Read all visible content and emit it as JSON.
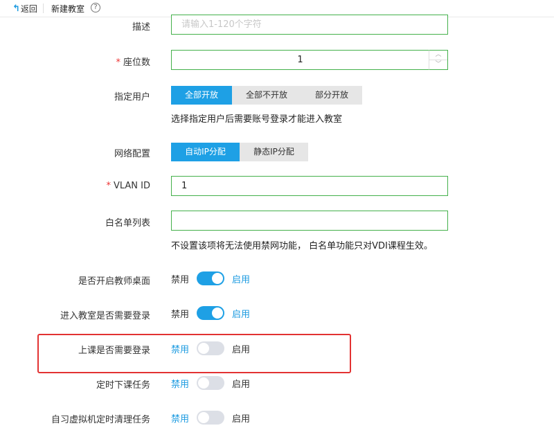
{
  "header": {
    "back_label": "返回",
    "title": "新建教室",
    "help_icon": "?"
  },
  "form": {
    "description": {
      "label": "描述",
      "placeholder": "请输入1-120个字符"
    },
    "seats": {
      "label": "座位数",
      "required_mark": "*",
      "value": "1"
    },
    "assign_user": {
      "label": "指定用户",
      "options": [
        "全部开放",
        "全部不开放",
        "部分开放"
      ],
      "selected": "全部开放",
      "hint": "选择指定用户后需要账号登录才能进入教室"
    },
    "network": {
      "label": "网络配置",
      "options": [
        "自动IP分配",
        "静态IP分配"
      ],
      "selected": "自动IP分配"
    },
    "vlan": {
      "label": "VLAN ID",
      "required_mark": "*",
      "value": "1"
    },
    "whitelist": {
      "label": "白名单列表",
      "value": "",
      "hint": "不设置该项将无法使用禁网功能， 白名单功能只对VDI课程生效。"
    },
    "toggles": [
      {
        "label": "是否开启教师桌面",
        "off_label": "禁用",
        "on_label": "启用",
        "state": "on"
      },
      {
        "label": "进入教室是否需要登录",
        "off_label": "禁用",
        "on_label": "启用",
        "state": "on"
      },
      {
        "label": "上课是否需要登录",
        "off_label": "禁用",
        "on_label": "启用",
        "state": "off"
      },
      {
        "label": "定时下课任务",
        "off_label": "禁用",
        "on_label": "启用",
        "state": "off"
      },
      {
        "label": "自习虚拟机定时清理任务",
        "off_label": "禁用",
        "on_label": "启用",
        "state": "off"
      }
    ]
  },
  "colors": {
    "accent": "#1ea0e5",
    "input_border": "#43b04a",
    "highlight": "#e23232",
    "required": "#ee3333"
  }
}
